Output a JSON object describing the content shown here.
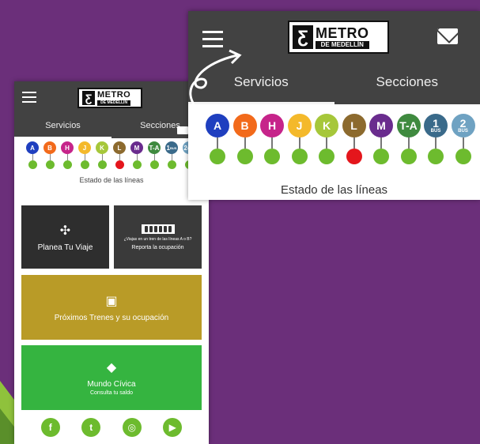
{
  "app": {
    "logo_main": "METRO",
    "logo_sub": "DE MEDELLÍN"
  },
  "tabs": {
    "servicios": "Servicios",
    "secciones": "Secciones"
  },
  "lines": [
    {
      "label": "A",
      "sub": "",
      "color": "#1f3fbf",
      "status": "#6dbb2e"
    },
    {
      "label": "B",
      "sub": "",
      "color": "#f26a1b",
      "status": "#6dbb2e"
    },
    {
      "label": "H",
      "sub": "",
      "color": "#c6248a",
      "status": "#6dbb2e"
    },
    {
      "label": "J",
      "sub": "",
      "color": "#f4b92b",
      "status": "#6dbb2e"
    },
    {
      "label": "K",
      "sub": "",
      "color": "#a6c73a",
      "status": "#6dbb2e"
    },
    {
      "label": "L",
      "sub": "",
      "color": "#8c6a2e",
      "status": "#e4161c"
    },
    {
      "label": "M",
      "sub": "",
      "color": "#6a2c8e",
      "status": "#6dbb2e"
    },
    {
      "label": "T-A",
      "sub": "",
      "color": "#3f8a3f",
      "status": "#6dbb2e"
    },
    {
      "label": "1",
      "sub": "BUS",
      "color": "#3a6a8a",
      "status": "#6dbb2e"
    },
    {
      "label": "2",
      "sub": "BUS",
      "color": "#6fa2c2",
      "status": "#6dbb2e"
    }
  ],
  "status_title": "Estado de las líneas",
  "cards": {
    "plan": {
      "title": "Planea Tu Viaje"
    },
    "report": {
      "small": "¿Viajas en un tren de las líneas A o B?",
      "title": "Reporta la ocupación"
    },
    "trains": {
      "title": "Próximos Trenes y su ocupación"
    },
    "civica": {
      "title": "Mundo Cívica",
      "sub": "Consulta tu saldo"
    }
  },
  "social": [
    {
      "icon": "facebook-icon",
      "glyph": "f"
    },
    {
      "icon": "twitter-icon",
      "glyph": "t"
    },
    {
      "icon": "instagram-icon",
      "glyph": "◎"
    },
    {
      "icon": "youtube-icon",
      "glyph": "▶"
    }
  ]
}
